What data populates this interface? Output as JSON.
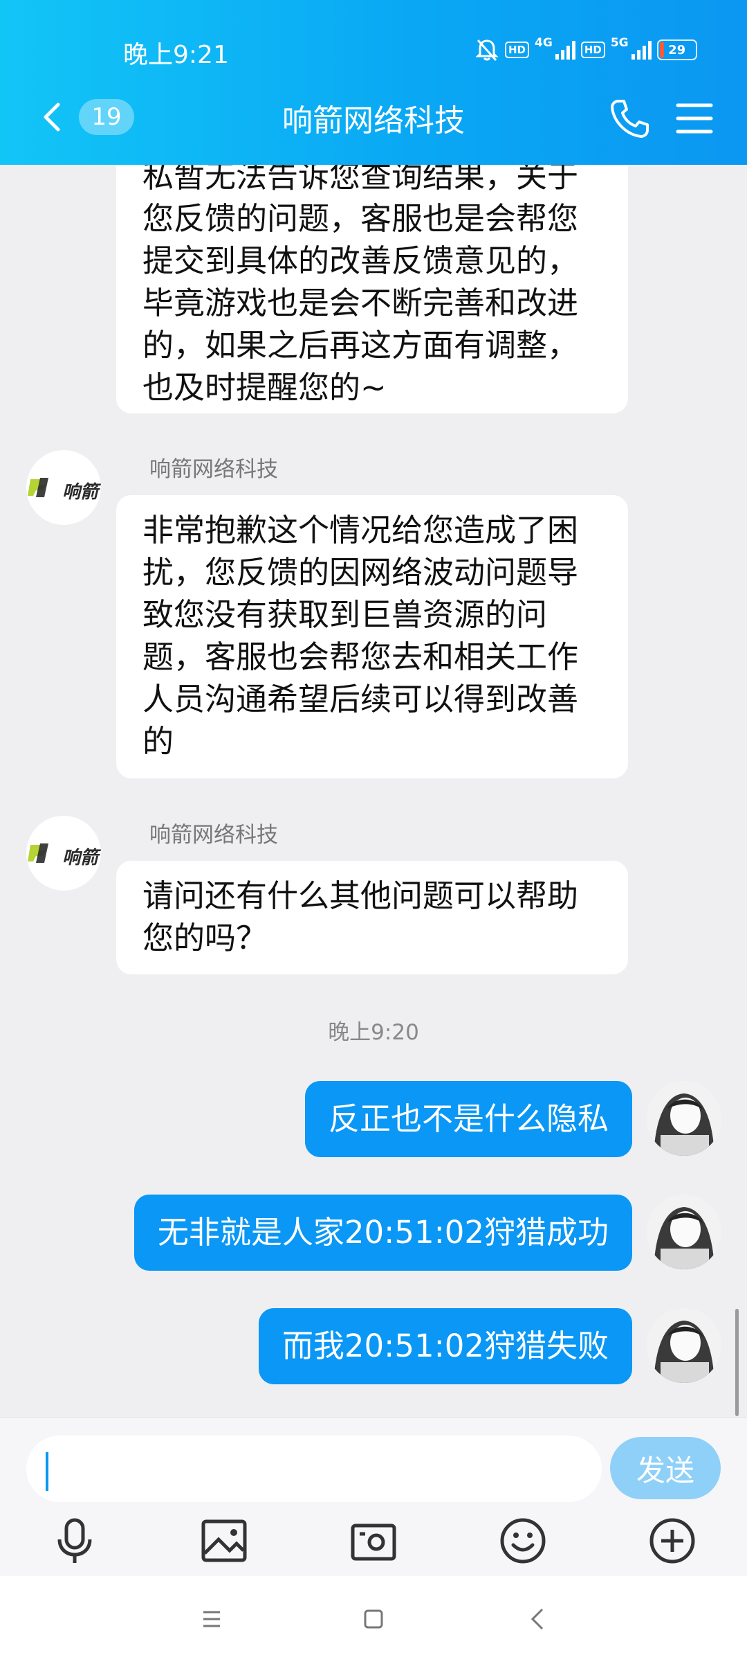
{
  "status_bar": {
    "time": "晚上9:21",
    "hd": "HD",
    "net1": "4G",
    "net2": "5G",
    "battery": "29"
  },
  "header": {
    "unread_count": "19",
    "title": "响箭网络科技"
  },
  "messages": {
    "m0": {
      "text": "私暂无法告诉您查询结果，关于\n您反馈的问题，客服也是会帮您\n提交到具体的改善反馈意见的，\n毕竟游戏也是会不断完善和改进\n的，如果之后再这方面有调整，\n也及时提醒您的~"
    },
    "m1": {
      "sender": "响箭网络科技",
      "text": "非常抱歉这个情况给您造成了困\n扰，您反馈的因网络波动问题导\n致您没有获取到巨兽资源的问\n题，客服也会帮您去和相关工作\n人员沟通希望后续可以得到改善\n的"
    },
    "m2": {
      "sender": "响箭网络科技",
      "text": "请问还有什么其他问题可以帮助\n您的吗？"
    },
    "time_separator": "晚上9:20",
    "m3": {
      "text": "反正也不是什么隐私"
    },
    "m4": {
      "text": "无非就是人家20:51:02狩猎成功"
    },
    "m5": {
      "text": "而我20:51:02狩猎失败"
    },
    "bot_avatar_label": "响箭"
  },
  "input": {
    "value": "",
    "send_label": "发送"
  },
  "colors": {
    "accent": "#0a97f5",
    "header_gradient_start": "#12c5f7",
    "logo_green": "#b5d334"
  }
}
